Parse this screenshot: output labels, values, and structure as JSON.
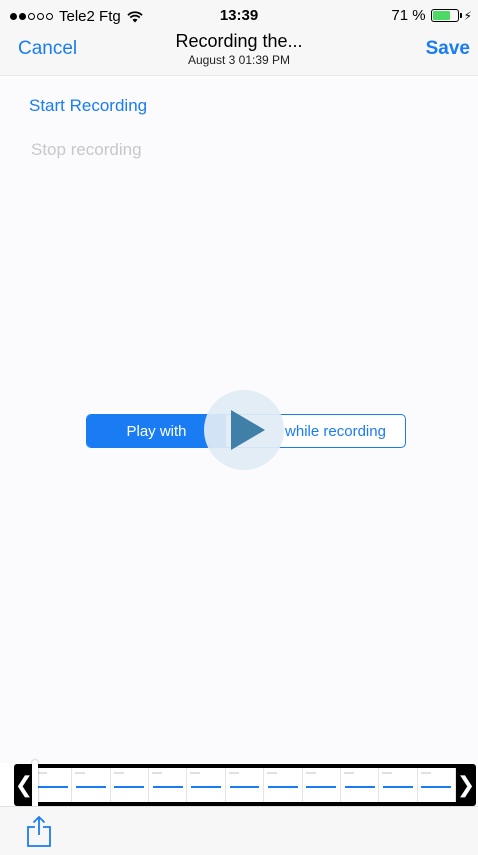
{
  "status_bar": {
    "carrier": "Tele2 Ftg",
    "time": "13:39",
    "battery_text": "71 %",
    "battery_level": 0.71,
    "signal_bars_filled": 2,
    "signal_bars_total": 5
  },
  "nav": {
    "cancel_label": "Cancel",
    "title": "Recording the...",
    "subtitle": "August 3 01:39 PM",
    "save_label": "Save"
  },
  "content": {
    "start_recording": "Start Recording",
    "stop_recording": "Stop recording"
  },
  "segmented": {
    "left_label": "Play with",
    "right_label": "while recording"
  },
  "timeline": {
    "frame_count": 11,
    "left_handle": "❮",
    "right_handle": "❯"
  },
  "icons": {
    "play": "play-icon",
    "share": "share-icon",
    "wifi": "wifi-icon",
    "battery": "battery-icon"
  },
  "colors": {
    "accent": "#1a7cf2",
    "disabled": "#c7c7cc",
    "battery_fill": "#4cd964"
  }
}
